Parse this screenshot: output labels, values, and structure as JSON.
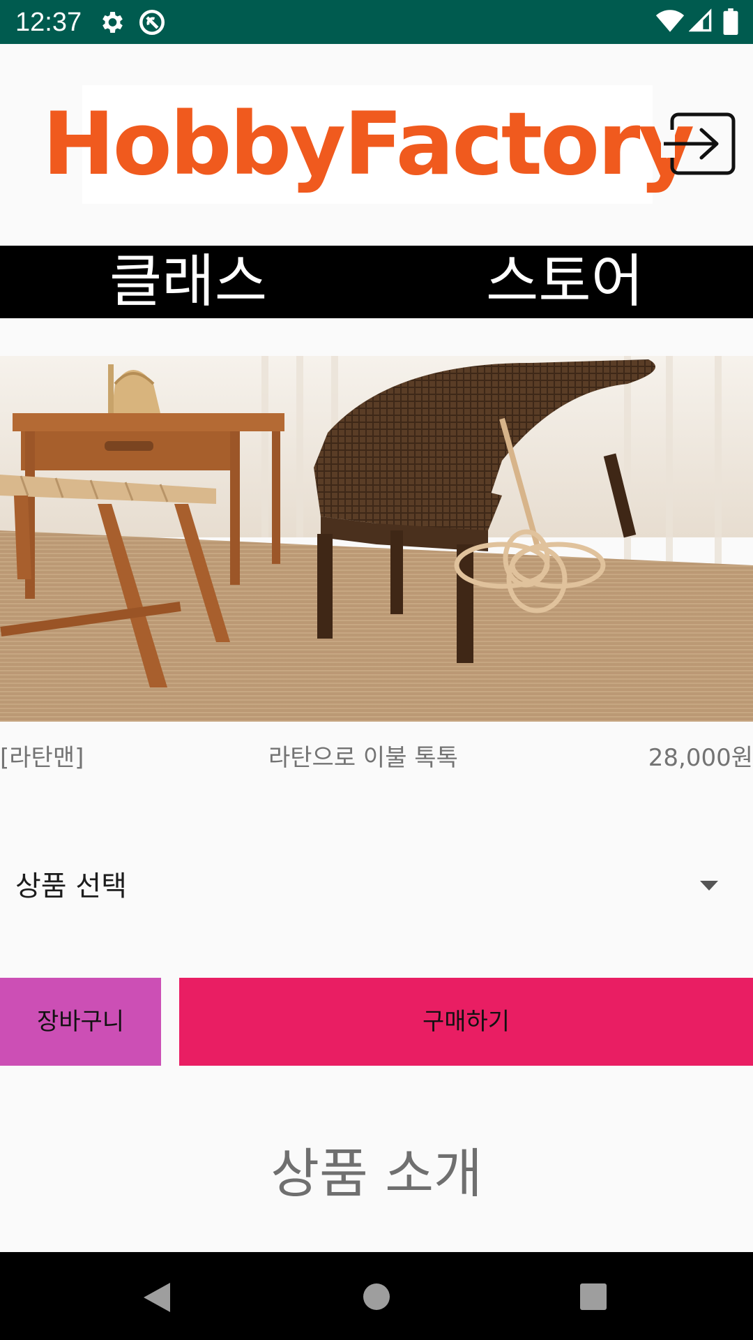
{
  "status_bar": {
    "time": "12:37",
    "icons": [
      "gear-icon",
      "sync-off-icon",
      "wifi-icon",
      "signal-icon",
      "battery-icon"
    ],
    "background": "#005b4f"
  },
  "header": {
    "logo_text": "HobbyFactory",
    "logo_color": "#f05a1e",
    "logout_icon": "logout-icon"
  },
  "tabs": [
    {
      "label": "클래스"
    },
    {
      "label": "스토어"
    }
  ],
  "product": {
    "brand": "[라탄맨]",
    "name": "라탄으로 이불 톡톡",
    "price": "28,000원"
  },
  "option_select": {
    "selected": "상품 선택",
    "icon": "dropdown-arrow-icon"
  },
  "buttons": {
    "cart_label": "장바구니",
    "cart_color": "#cc4fb5",
    "buy_label": "구매하기",
    "buy_color": "#e91e63"
  },
  "section": {
    "title": "상품 소개"
  },
  "nav_bar": {
    "icons": [
      "back-icon",
      "home-icon",
      "recents-icon"
    ]
  }
}
